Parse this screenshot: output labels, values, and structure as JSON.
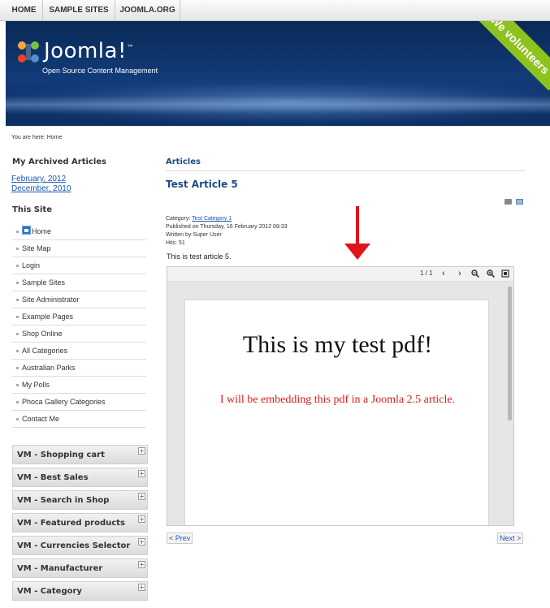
{
  "topnav": {
    "items": [
      {
        "label": "HOME"
      },
      {
        "label": "SAMPLE SITES"
      },
      {
        "label": "JOOMLA.ORG"
      }
    ]
  },
  "header": {
    "brand": "Joomla!",
    "trademark": "™",
    "tagline": "Open Source Content Management",
    "ribbon_text": "We volunteers"
  },
  "breadcrumb": "You are here: Home",
  "sidebar": {
    "archived_title": "My Archived Articles",
    "archived_links": [
      "February, 2012",
      "December, 2010"
    ],
    "site_title": "This Site",
    "site_items": [
      "Home",
      "Site Map",
      "Login",
      "Sample Sites",
      "Site Administrator",
      "Example Pages",
      "Shop Online",
      "All Categories",
      "Australian Parks",
      "My Polls",
      "Phoca Gallery Categories",
      "Contact Me"
    ],
    "vm_modules": [
      "VM - Shopping cart",
      "VM - Best Sales",
      "VM - Search in Shop",
      "VM - Featured products",
      "VM - Currencies Selector",
      "VM - Manufacturer",
      "VM - Category"
    ]
  },
  "main": {
    "heading": "Articles",
    "article_title": "Test Article 5",
    "category_label": "Category: ",
    "category_link": "Test Category 1",
    "published": "Published on Thursday, 16 February 2012 08:33",
    "written": "Written by Super User",
    "hits": "Hits: 51",
    "intro": "This is test article 5.",
    "pdf": {
      "page_counter": "1 / 1",
      "title": "This is my test pdf!",
      "text": "I will be embedding this pdf in a Joomla 2.5 article."
    },
    "prev": "< Prev",
    "next": "Next >"
  },
  "colors": {
    "header_bg": "#123b7a",
    "link": "#1b57b1",
    "heading": "#1d4b84",
    "pdf_red_text": "#e01b1b",
    "arrow": "#e0141a",
    "ribbon": "#8ec21f"
  }
}
